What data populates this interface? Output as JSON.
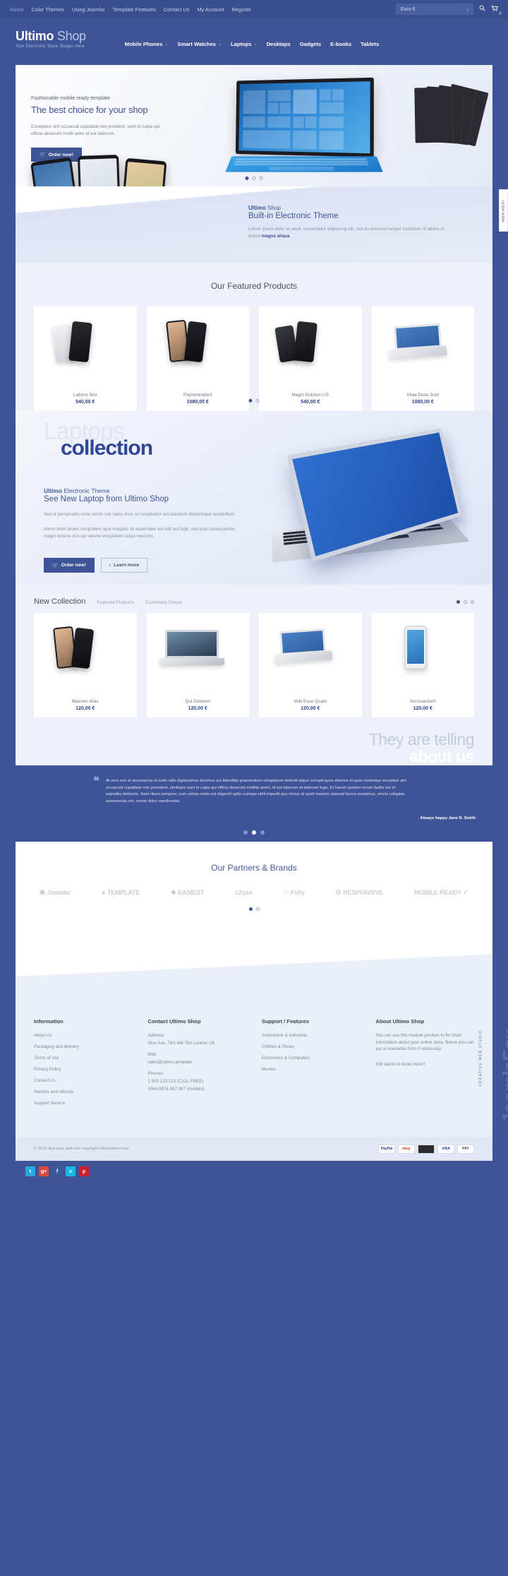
{
  "topbar": {
    "links": [
      {
        "label": "Home",
        "active": true
      },
      {
        "label": "Color Themes",
        "active": false
      },
      {
        "label": "Using Joomla!",
        "active": false
      },
      {
        "label": "Template Features",
        "active": false
      },
      {
        "label": "Contact Us",
        "active": false
      },
      {
        "label": "My Account",
        "active": false
      },
      {
        "label": "Register",
        "active": false
      }
    ],
    "currency": "Euro €",
    "currency_arrow": "›",
    "search_icon": "search-icon",
    "cart_icon": "cart-icon",
    "cart_count": "0"
  },
  "header": {
    "logo_main": "Ultimo",
    "logo_sub": "Shop",
    "slogan": "Your Electronic Store Slogan Here",
    "nav": [
      {
        "label": "Mobile Phones",
        "caret": true
      },
      {
        "label": "Smart Watches",
        "caret": true
      },
      {
        "label": "Laptops",
        "caret": true
      },
      {
        "label": "Desktops",
        "caret": false
      },
      {
        "label": "Gadgets",
        "caret": false
      },
      {
        "label": "E-books",
        "caret": false
      },
      {
        "label": "Tablets",
        "caret": false
      }
    ]
  },
  "hero": {
    "kicker": "Fashionable mobile ready template",
    "title": "The best choice for your shop",
    "paragraph": "Excepteur sint occaecat cupidatat non proident, sunt in culpa qui officia deserunt mollit anim id est laborum.",
    "button": "Order now!",
    "cart_icon": "cart-icon",
    "slides": 3,
    "active_slide": 1
  },
  "builtin": {
    "sup_bold": "Ultimo",
    "sup_light": "Shop",
    "title": "Built-in Electronic Theme",
    "paragraph_1": "Lorem ipsum dolor sit amet, consectetur adipiscing elit, sed do eiusmod tempor incididunt ut labore et dolore ",
    "paragraph_bold": "magna aliqua",
    "paragraph_2": "."
  },
  "featured": {
    "title": "Our Featured Products",
    "products": [
      {
        "name": "Laboris Nisi",
        "price": "540,00 €",
        "art": "phone-white"
      },
      {
        "name": "Reprehenderit",
        "price": "1080,00 €",
        "art": "phone-duo"
      },
      {
        "name": "Magni Dolores L/S",
        "price": "540,00 €",
        "art": "phone-black"
      },
      {
        "name": "Vitae Dicta Sunt",
        "price": "1080,00 €",
        "art": "tablet-kbd"
      }
    ],
    "slides": 2,
    "active_slide": 1
  },
  "collection": {
    "ghost_word": "Laptops",
    "big_word": "collection",
    "sup_bold": "Ultimo",
    "sup_light": "Electronic Theme",
    "title": "See New Laptop from Ultimo Shop",
    "paragraph_1": "Sed ut perspiciatis unde omnis iste natus error sit voluptatem accusantium doloremque laudantium.",
    "paragraph_2": "Nemo enim ipsam voluptatem quia voluptas sit aspernatur aut odit aut fugit, sed quia consequuntur magni dolores eos qui ratione voluptatem sequi nesciunt.",
    "button_primary": "Order now!",
    "button_secondary": "Learn more",
    "arrow_icon": "chevron-right-icon",
    "cart_icon": "cart-icon"
  },
  "newcollection": {
    "title": "New Collection",
    "tabs": [
      {
        "label": "Featured Products",
        "active": false
      },
      {
        "label": "Customers Choice",
        "active": false
      }
    ],
    "products": [
      {
        "name": "Maiores Alias",
        "price": "120,00 €",
        "art": "phone-duo"
      },
      {
        "name": "Qui Dolorem",
        "price": "120,00 €",
        "art": "macbook"
      },
      {
        "name": "Velit Esse Quam",
        "price": "120,00 €",
        "art": "tablet-kbd"
      },
      {
        "name": "Accusantium",
        "price": "120,00 €",
        "art": "iphone-white"
      }
    ],
    "slides": 3,
    "active_slide": 1
  },
  "testimonial": {
    "heading_light": "They are telling",
    "heading_bold": "about us",
    "quote_mark": "❝",
    "text": "At vero eos et accusamus et iusto odio dignissimos ducimus qui blanditiis praesentium voluptatum deleniti atque corrupti quos dolores et quas molestias excepturi sint occaecati cupiditate non provident, similique sunt in culpa qui officia deserunt mollitia animi, id est laborum et dolorum fuga. Et harum quidem rerum facilis est et expedita distinctio. Nam libero tempore, cum soluta nobis est eligendi optio cumque nihil impedit quo minus id quod maxime placeat facere possimus, omnis voluptas assumenda est, omnis dolor repellendus.",
    "author": "Always happy Jane D. Smith",
    "slides": 3,
    "active_slide": 2
  },
  "partners": {
    "title": "Our Partners & Brands",
    "brands": [
      {
        "label": "Joomla!",
        "icon": "joomla-icon"
      },
      {
        "label": "TEMPLATE",
        "icon": "circle-icon"
      },
      {
        "label": "EASIEST",
        "icon": "shield-icon"
      },
      {
        "label": "c2use",
        "icon": "c2use-icon"
      },
      {
        "label": "Fully",
        "icon": "diamond-icon"
      },
      {
        "label": "RESPONSIVE",
        "icon": "circle-icon"
      },
      {
        "label": "MOBILE READY",
        "icon": "check-icon"
      }
    ],
    "slides": 2,
    "active_slide": 1
  },
  "footer": {
    "columns": [
      {
        "heading": "Information",
        "items": [
          "About Us",
          "Packaging and delivery",
          "Terms of use",
          "Privacy Policy",
          "Contact Us",
          "Returns and refunds",
          "Support Service"
        ]
      },
      {
        "heading": "Contact Ultimo Shop",
        "items": [
          "Address:",
          "Nice Ave. 78/1 6M 78A London UK",
          "",
          "Mail:",
          "sales@ultimo.template",
          "",
          "Phones:",
          "1 800 123 123 (CALL FREE)",
          "0044 9876 987 987 (mobiles)"
        ]
      },
      {
        "heading": "Support / Features",
        "items": [
          "Automotive & Industrial",
          "Clothes & Shoes",
          "Electronics & Computers",
          "Movies"
        ]
      },
      {
        "heading": "About Ultimo Shop",
        "text": "You can use this module position to for short information about your online store. Below you can put a newsletter form if necessary.",
        "text2": "Still wants to know more?"
      }
    ],
    "watermark_title": "Joomla",
    "watermark_title2": "Fox",
    "watermark_sub": "CREATIVE WEB STUDIO",
    "copyright": "© 2015 And your web site copyright information here",
    "payments": [
      "PayPal",
      "ebay",
      "card",
      "VISA",
      "PAY"
    ],
    "social": [
      {
        "label": "t",
        "color": "#29a9e0",
        "name": "twitter-icon"
      },
      {
        "label": "g+",
        "color": "#d94a38",
        "name": "google-plus-icon"
      },
      {
        "label": "f",
        "color": "#3b5998",
        "name": "facebook-icon"
      },
      {
        "label": "v",
        "color": "#1ab7ea",
        "name": "vimeo-icon"
      },
      {
        "label": "p",
        "color": "#cb2027",
        "name": "pinterest-icon"
      }
    ]
  },
  "helptab": {
    "label": "NEED HELP?"
  }
}
